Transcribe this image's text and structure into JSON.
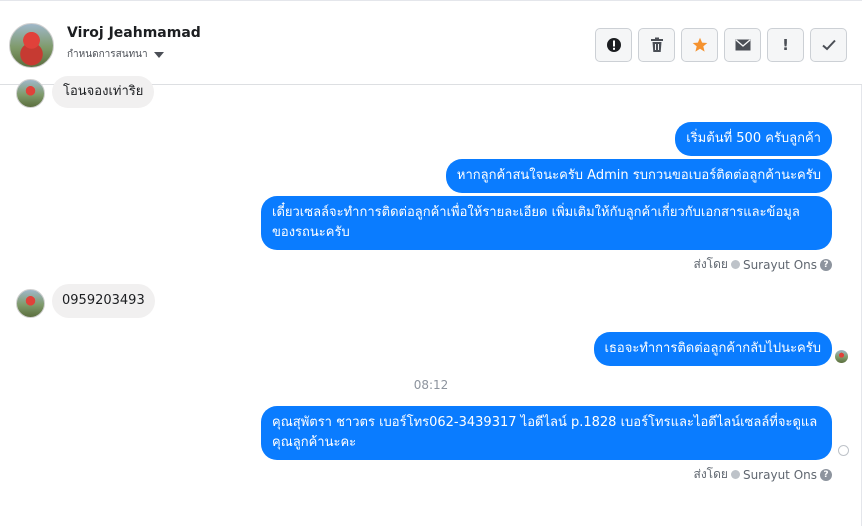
{
  "header": {
    "contact_name": "Viroj Jeahmamad",
    "contact_sub": "กำหนดการสนทนา",
    "actions": [
      {
        "name": "report-spam-icon"
      },
      {
        "name": "trash-icon"
      },
      {
        "name": "star-icon",
        "color": "#f5922f"
      },
      {
        "name": "envelope-icon"
      },
      {
        "label": "!"
      },
      {
        "name": "checkmark-icon"
      }
    ]
  },
  "messages": {
    "in_partial": "โอนจองเท่าริย",
    "out_1": "เริ่มต้นที่ 500 ครับลูกค้า",
    "out_2": "หากลูกค้าสนใจนะครับ Admin รบกวนขอเบอร์ติดต่อลูกค้านะครับ",
    "out_3": "เดี๋ยวเซลล์จะทำการติดต่อลูกค้าเพื่อให้รายละเอียด เพิ่มเติมให้กับลูกค้าเกี่ยวกับเอกสารและข้อมูลของรถนะครับ",
    "sent_by_1_label": "ส่งโดย",
    "sent_by_1_name": "Surayut Ons",
    "in_phone": "0959203493",
    "out_4": "เธอจะทำการติดต่อลูกค้ากลับไปนะครับ",
    "timestamp": "08:12",
    "out_5": "คุณสุพัตรา  ชาวตร เบอร์โทร062-3439317 ไอดีไลน์ p.1828  เบอร์โทรและไอดีไลน์เซลล์ที่จะดูแลคุณลูกค้านะคะ",
    "sent_by_2_label": "ส่งโดย",
    "sent_by_2_name": "Surayut Ons"
  },
  "colors": {
    "outgoing_bubble": "#0a7cff",
    "incoming_bubble": "#f1f0f0"
  }
}
